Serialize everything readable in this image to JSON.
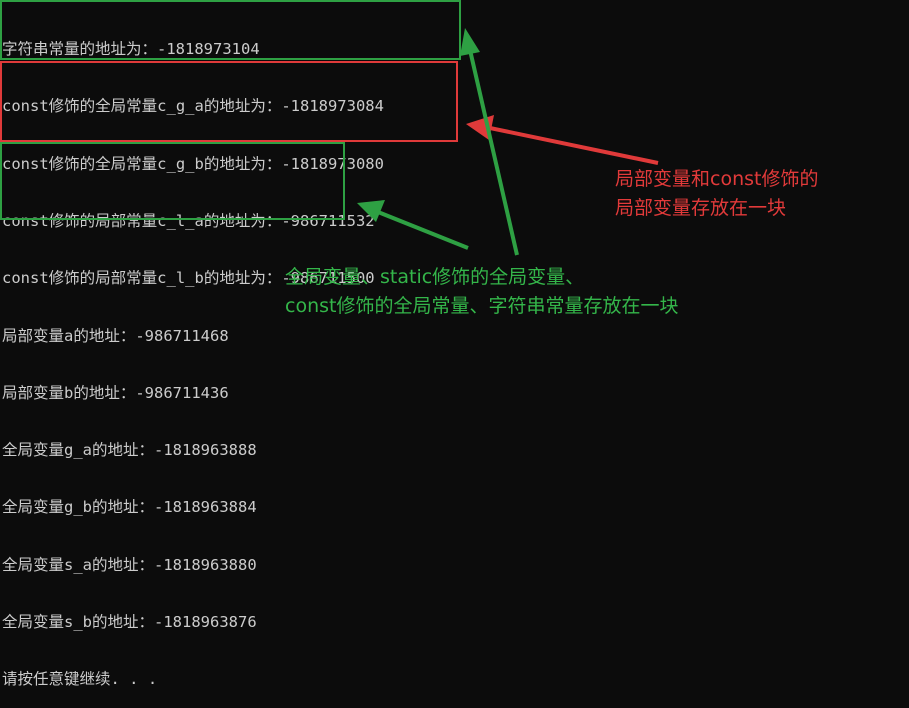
{
  "console": {
    "lines": [
      "字符串常量的地址为：-1818973104",
      "const修饰的全局常量c_g_a的地址为：-1818973084",
      "const修饰的全局常量c_g_b的地址为：-1818973080",
      "const修饰的局部常量c_l_a的地址为：-986711532",
      "const修饰的局部常量c_l_b的地址为：-986711500",
      "局部变量a的地址：-986711468",
      "局部变量b的地址：-986711436",
      "全局变量g_a的地址：-1818963888",
      "全局变量g_b的地址：-1818963884",
      "全局变量s_a的地址：-1818963880",
      "全局变量s_b的地址：-1818963876",
      "请按任意键继续. . ."
    ]
  },
  "annotations": {
    "red_note": [
      "局部变量和const修饰的",
      "局部变量存放在一块"
    ],
    "green_note": [
      "全局变量、static修饰的全局变量、",
      "const修饰的全局常量、字符串常量存放在一块"
    ]
  },
  "colors": {
    "background": "#0c0c0c",
    "console_text": "#cccccc",
    "green": "#2ea043",
    "red": "#e03a3a"
  }
}
